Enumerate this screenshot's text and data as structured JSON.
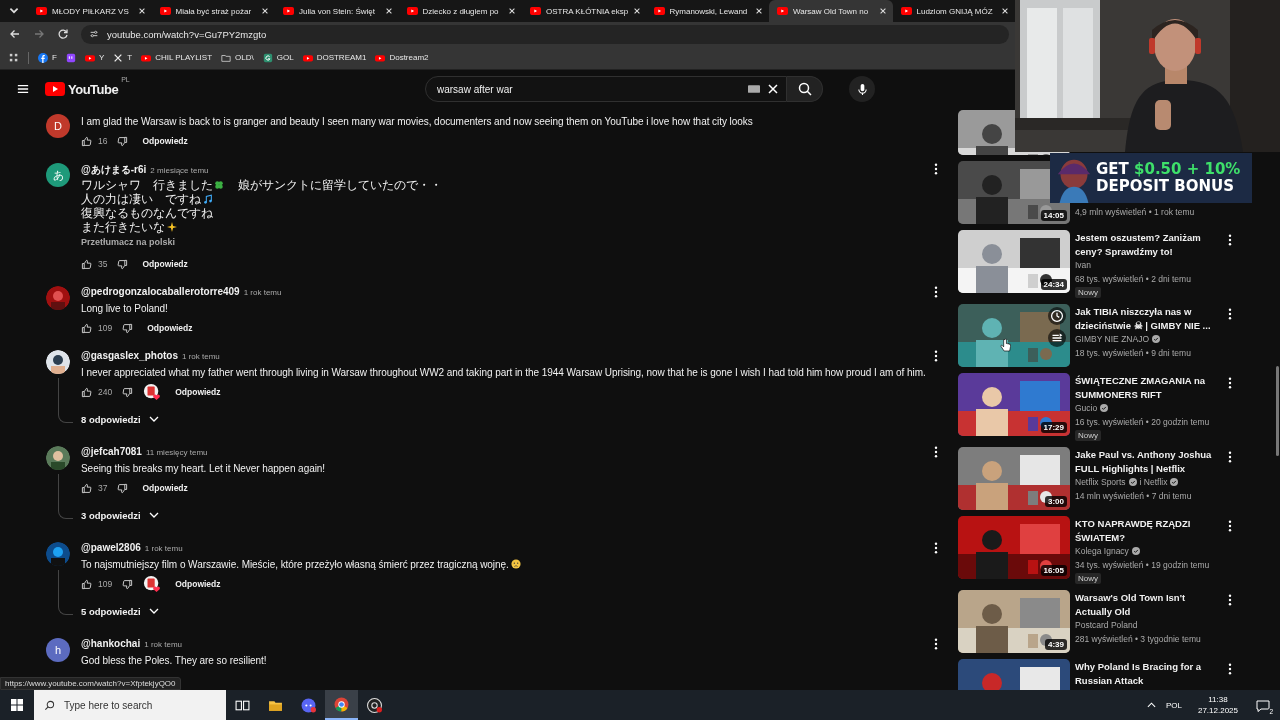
{
  "browser": {
    "tabs": [
      {
        "title": "MŁODY PIŁKARZ VS",
        "selected": false
      },
      {
        "title": "Miała być straż pożar",
        "selected": false
      },
      {
        "title": "Julia von Stein: Święt",
        "selected": false
      },
      {
        "title": "Dziecko z długiem po",
        "selected": false
      },
      {
        "title": "OSTRA KŁÓTNIA eksp",
        "selected": false
      },
      {
        "title": "Rymanowski, Lewand",
        "selected": false
      },
      {
        "title": "Warsaw Old Town no",
        "selected": true
      },
      {
        "title": "Ludziom GNIJĄ MÓZ",
        "selected": false
      }
    ],
    "url": "youtube.com/watch?v=Gu7PY2mzgto",
    "bookmarks": [
      {
        "kind": "facebook",
        "label": "F"
      },
      {
        "kind": "twitch"
      },
      {
        "kind": "youtube",
        "label": "Y"
      },
      {
        "kind": "x",
        "label": "T"
      },
      {
        "kind": "youtube",
        "label": "CHIL PLAYLIST"
      },
      {
        "kind": "folder",
        "label": "OLD\\"
      },
      {
        "kind": "g",
        "label": "GOL"
      },
      {
        "kind": "youtube",
        "label": "DOSTREAM1"
      },
      {
        "kind": "youtube",
        "label": "Dostream2"
      }
    ],
    "status_url": "https://www.youtube.com/watch?v=XfptekjyQO0"
  },
  "youtube": {
    "logo": "YouTube",
    "region": "PL",
    "search": "warsaw after war"
  },
  "comments": [
    {
      "avatar": {
        "kind": "letter",
        "letter": "D",
        "color": "#c0392b"
      },
      "lines": [
        [
          {
            "kind": "text",
            "text": "I am glad the Warsaw is back to is granger and beauty I seen many war movies, documenters and now seeing them on YouTube i love how that city looks"
          }
        ]
      ],
      "likes": "16",
      "creator_heart": false,
      "reply": "Odpowiedz"
    },
    {
      "author": "@あけまる-r6i",
      "time": "2 miesiące temu",
      "avatar": {
        "kind": "letter",
        "letter": "あ",
        "color": "#1e9a7a"
      },
      "lines": [
        [
          {
            "kind": "jp-text",
            "text": "ワルシャワ　行きました"
          },
          {
            "kind": "clover"
          },
          {
            "kind": "jp-text",
            "text": "　娘がサンクトに留学していたので・・"
          }
        ],
        [
          {
            "kind": "jp-text",
            "text": "人の力は凄い　ですね"
          },
          {
            "kind": "note"
          }
        ],
        [
          {
            "kind": "jp-text",
            "text": "復興なるものなんですね"
          }
        ],
        [
          {
            "kind": "jp-text",
            "text": "また行きたいな"
          },
          {
            "kind": "sparkle"
          }
        ]
      ],
      "translate": "Przetłumacz na polski",
      "likes": "35",
      "creator_heart": false,
      "reply": "Odpowiedz"
    },
    {
      "author": "@pedrogonzalocaballerotorre409",
      "time": "1 rok temu",
      "avatar": {
        "kind": "picture"
      },
      "lines": [
        [
          {
            "kind": "text",
            "text": "Long live to Poland!"
          }
        ]
      ],
      "likes": "109",
      "creator_heart": false,
      "reply": "Odpowiedz"
    },
    {
      "author": "@gasgaslex_photos",
      "time": "1 rok temu",
      "avatar": {
        "kind": "picture"
      },
      "lines": [
        [
          {
            "kind": "text",
            "text": "I never appreciated what my father went through living in Warsaw throughout WW2 and taking part in the 1944 Warsaw Uprising, now that he is gone I wish I had told him how proud I am of him."
          }
        ]
      ],
      "likes": "240",
      "creator_heart": true,
      "reply": "Odpowiedz",
      "replies": "8 odpowiedzi"
    },
    {
      "author": "@jefcah7081",
      "time": "11 miesięcy temu",
      "avatar": {
        "kind": "picture"
      },
      "lines": [
        [
          {
            "kind": "text",
            "text": "Seeing this breaks my heart. Let it Never happen again!"
          }
        ]
      ],
      "likes": "37",
      "creator_heart": false,
      "reply": "Odpowiedz",
      "replies": "3 odpowiedzi"
    },
    {
      "author": "@pawel2806",
      "time": "1 rok temu",
      "avatar": {
        "kind": "picture"
      },
      "lines": [
        [
          {
            "kind": "text",
            "text": "To najsmutniejszy film o Warszawie. Mieście, które przeżyło własną śmierć przez tragiczną wojnę."
          },
          {
            "kind": "sad"
          }
        ]
      ],
      "likes": "109",
      "creator_heart": true,
      "reply": "Odpowiedz",
      "replies": "5 odpowiedzi"
    },
    {
      "author": "@hankochai",
      "time": "1 rok temu",
      "avatar": {
        "kind": "letter",
        "letter": "h",
        "color": "#5c6bc0"
      },
      "lines": [
        [
          {
            "kind": "text",
            "text": "God bless the Poles. They are so resilient!"
          }
        ]
      ]
    }
  ],
  "sidebar": {
    "items": [
      {
        "kind": "cut"
      },
      {
        "kind": "video",
        "duration": "14:05",
        "meta": "4,9 mln wyświetleń • 1 rok temu",
        "hovered": false
      },
      {
        "kind": "video",
        "title_lines": [
          "Jestem oszustem? Zaniżam",
          "ceny? Sprawdźmy to!"
        ],
        "channels": [
          {
            "name": "Ivan",
            "verified": false
          }
        ],
        "meta": "68 tys. wyświetleń • 2 dni temu",
        "badge": "Nowy",
        "duration": "24:34",
        "hovered": false
      },
      {
        "kind": "video",
        "title_lines": [
          "Jak TIBIA niszczyła nas w",
          "dzieciństwie ☠ | GIMBY NIE ..."
        ],
        "channels": [
          {
            "name": "GIMBY NIE ZNAJO",
            "verified": true
          }
        ],
        "meta": "18 tys. wyświetleń • 9 dni temu",
        "hovered": true
      },
      {
        "kind": "video",
        "title_lines": [
          "ŚWIĄTECZNE ZMAGANIA na",
          "SUMMONERS RIFT"
        ],
        "channels": [
          {
            "name": "Gucio",
            "verified": true
          }
        ],
        "meta": "16 tys. wyświetleń • 20 godzin temu",
        "badge": "Nowy",
        "duration": "17:29",
        "hovered": false
      },
      {
        "kind": "video",
        "title_lines": [
          "Jake Paul vs. Anthony Joshua",
          "FULL Highlights | Netflix"
        ],
        "channels": [
          {
            "name": "Netflix Sports",
            "verified": true
          },
          {
            "name": "i Netflix",
            "verified": true
          }
        ],
        "meta": "14 mln wyświetleń • 7 dni temu",
        "duration": "3:00",
        "hovered": false
      },
      {
        "kind": "video",
        "title_lines": [
          "KTO NAPRAWDĘ RZĄDZI",
          "ŚWIATEM?"
        ],
        "channels": [
          {
            "name": "Kolega Ignacy",
            "verified": true
          }
        ],
        "meta": "34 tys. wyświetleń • 19 godzin temu",
        "badge": "Nowy",
        "duration": "16:05",
        "hovered": false
      },
      {
        "kind": "video",
        "title_lines": [
          "Warsaw's Old Town Isn't",
          "Actually Old"
        ],
        "channels": [
          {
            "name": "Postcard Poland",
            "verified": false
          }
        ],
        "meta": "281 wyświetleń • 3 tygodnie temu",
        "duration": "4:39",
        "hovered": false
      },
      {
        "kind": "video",
        "title_lines": [
          "Why Poland Is Bracing for a",
          "Russian Attack"
        ],
        "hovered": false
      }
    ]
  },
  "ad": {
    "prefix": "GET",
    "highlight": "$0.50 + 10%",
    "line2": "DEPOSIT BONUS"
  },
  "taskbar": {
    "search_placeholder": "Type here to search",
    "apps": [
      {
        "kind": "task-view",
        "selected": false
      },
      {
        "kind": "explorer",
        "selected": false
      },
      {
        "kind": "discord",
        "selected": false
      },
      {
        "kind": "chrome",
        "selected": true
      },
      {
        "kind": "recorder",
        "selected": false
      }
    ],
    "language": "POL",
    "time": "11:38",
    "date": "27.12.2025",
    "notifications": "2"
  }
}
